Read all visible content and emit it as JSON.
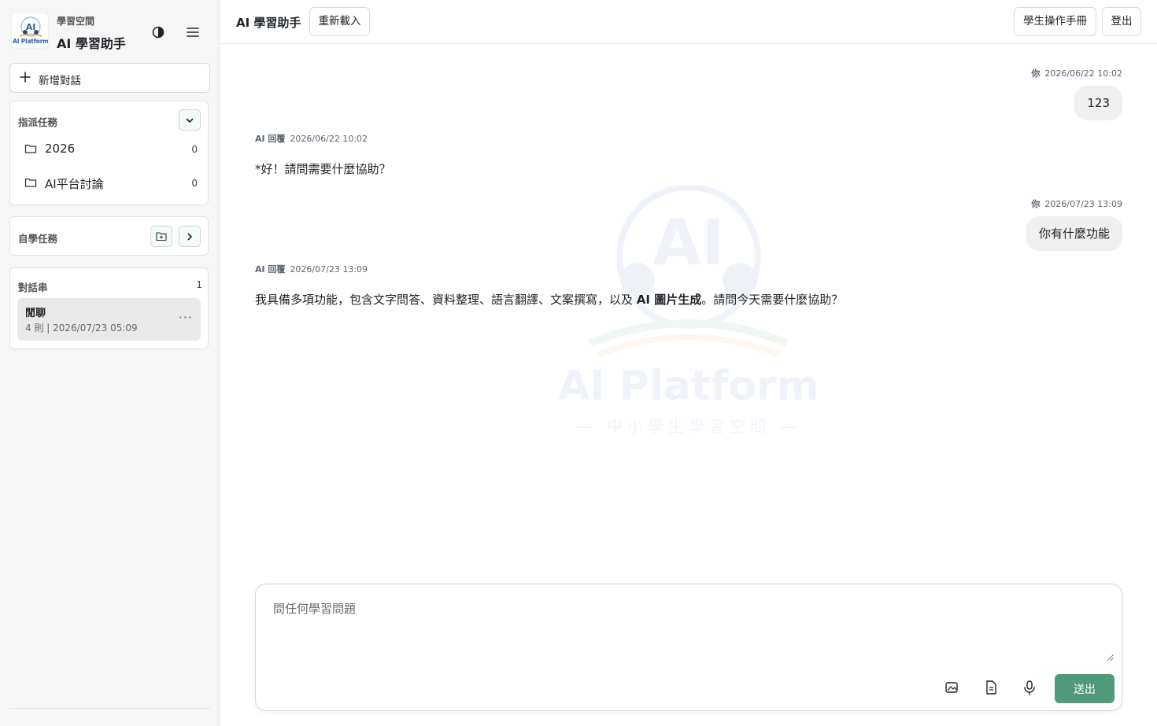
{
  "brand": {
    "logo_text": "AI Platform",
    "subtitle": "學習空間",
    "title": "AI 學習助手"
  },
  "sidebar": {
    "new_chat_label": "新增對話",
    "assigned": {
      "title": "指派任務",
      "folders": [
        {
          "name": "2026",
          "count": "0"
        },
        {
          "name": "AI平台討論",
          "count": "0"
        }
      ]
    },
    "self_study": {
      "title": "自學任務"
    },
    "threads": {
      "title": "對話串",
      "count": "1",
      "items": [
        {
          "name": "閒聊",
          "meta": "4 則 | 2026/07/23 05:09",
          "more": "···"
        }
      ]
    }
  },
  "header": {
    "title": "AI 學習助手",
    "reload_label": "重新載入",
    "manual_label": "學生操作手冊",
    "logout_label": "登出"
  },
  "chat": {
    "watermark_title": "AI Platform",
    "watermark_sub": "— 中小學生學習空間 —",
    "messages": [
      {
        "role": "你",
        "time": "2026/06/22 10:02",
        "text": "123"
      },
      {
        "role": "AI 回覆",
        "time": "2026/06/22 10:02",
        "text": "*好！請問需要什麼協助？"
      },
      {
        "role": "你",
        "time": "2026/07/23 13:09",
        "text": "你有什麼功能"
      },
      {
        "role": "AI 回覆",
        "time": "2026/07/23 13:09",
        "text_before": "我具備多項功能，包含文字問答、資料整理、語言翻譯、文案撰寫，以及 ",
        "text_bold": "AI 圖片生成",
        "text_after": "。請問今天需要什麼協助？"
      }
    ]
  },
  "composer": {
    "placeholder": "問任何學習問題",
    "send_label": "送出"
  },
  "colors": {
    "accent": "#4f9a7a",
    "sidebar_bg": "#f6f6f6",
    "bubble_bg": "#f0f0f0"
  }
}
